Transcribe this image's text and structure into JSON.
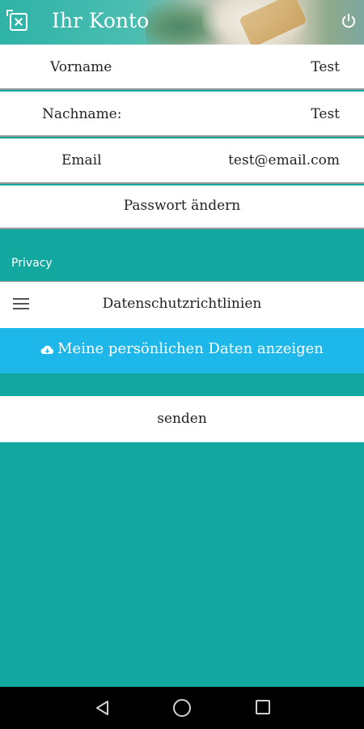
{
  "header": {
    "title": "Ihr Konto",
    "left_icon": "close-menu-icon",
    "right_icon": "power-icon"
  },
  "profile": {
    "first_name_label": "Vorname",
    "first_name_value": "Test",
    "last_name_label": "Nachname:",
    "last_name_value": "Test",
    "email_label": "Email",
    "email_value": "test@email.com",
    "change_password_label": "Passwort ändern"
  },
  "privacy": {
    "section_label": "Privacy",
    "policy_label": "Datenschutzrichtlinien",
    "show_data_label": "Meine persönlichen Daten anzeigen",
    "send_label": "senden"
  },
  "colors": {
    "background": "#12a89f",
    "accent_button": "#1eb7e9"
  }
}
